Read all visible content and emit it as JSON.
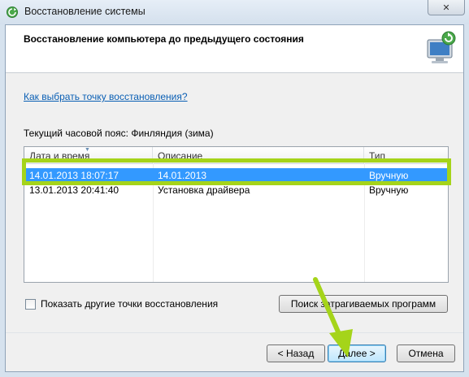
{
  "window": {
    "title": "Восстановление системы",
    "close_glyph": "✕"
  },
  "header": {
    "title": "Восстановление компьютера до предыдущего состояния",
    "icon": "system-restore-icon"
  },
  "help_link": "Как выбрать точку восстановления?",
  "timezone_text": "Текущий часовой пояс: Финляндия (зима)",
  "table": {
    "columns": [
      "Дата и время",
      "Описание",
      "Тип"
    ],
    "rows": [
      {
        "date": "14.01.2013 18:07:17",
        "description": "14.01.2013",
        "type": "Вручную",
        "selected": true
      },
      {
        "date": "13.01.2013 20:41:40",
        "description": "Установка драйвера",
        "type": "Вручную",
        "selected": false
      }
    ]
  },
  "show_more_checkbox": {
    "label": "Показать другие точки восстановления",
    "checked": false
  },
  "buttons": {
    "scan": "Поиск затрагиваемых программ",
    "back": "< Назад",
    "next": "Далее >",
    "cancel": "Отмена"
  },
  "colors": {
    "selection": "#3399ff",
    "annotation": "#a5d41a",
    "link": "#0a5fb4"
  }
}
